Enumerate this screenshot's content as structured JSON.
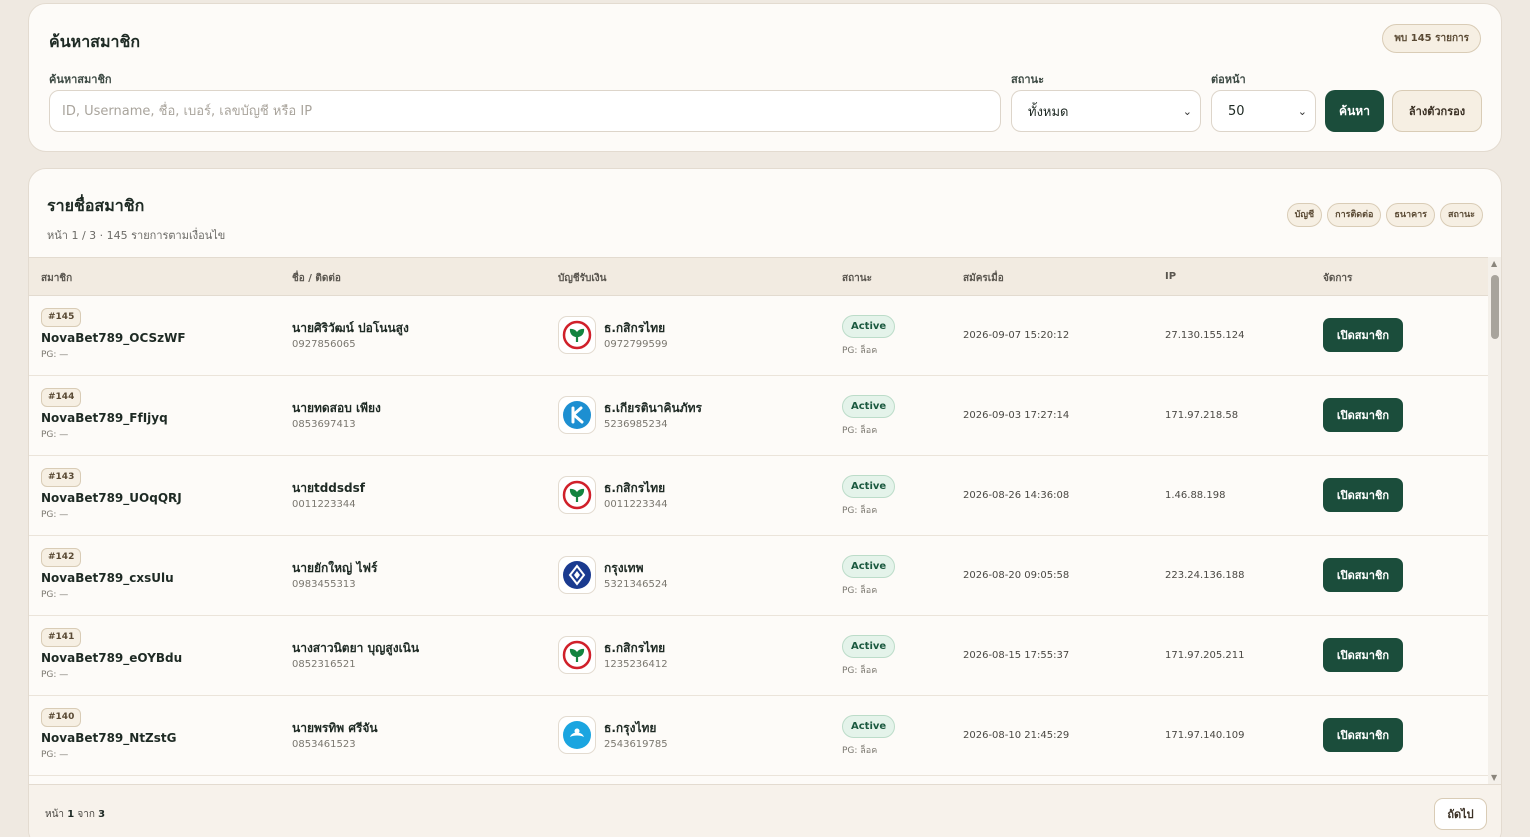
{
  "search": {
    "title": "ค้นหาสมาชิก",
    "count_badge": "พบ 145 รายการ",
    "search_label": "ค้นหาสมาชิก",
    "search_placeholder": "ID, Username, ชื่อ, เบอร์, เลขบัญชี หรือ IP",
    "search_value": "",
    "status_label": "สถานะ",
    "status_value": "ทั้งหมด",
    "per_page_label": "ต่อหน้า",
    "per_page_value": "50",
    "search_button": "ค้นหา",
    "clear_button": "ล้างตัวกรอง"
  },
  "list": {
    "title": "รายชื่อสมาชิก",
    "subtitle": "หน้า 1 / 3 · 145 รายการตามเงื่อนไข",
    "chips": [
      "บัญชี",
      "การติดต่อ",
      "ธนาคาร",
      "สถานะ"
    ],
    "columns": [
      "สมาชิก",
      "ชื่อ / ติดต่อ",
      "บัญชีรับเงิน",
      "สถานะ",
      "สมัครเมื่อ",
      "IP",
      "จัดการ"
    ],
    "rows": [
      {
        "id": "#145",
        "username": "NovaBet789_OCSzWF",
        "pg": "PG: —",
        "name": "นายศิริวัฒน์ ปอโนนสูง",
        "phone": "0927856065",
        "bank_name": "ธ.กสิกรไทย",
        "bank_acc": "0972799599",
        "bank_icon": "kbank-icon",
        "status": "Active",
        "status_pg": "PG: ล็อค",
        "date": "2026-09-07 15:20:12",
        "ip": "27.130.155.124",
        "action": "เปิดสมาชิก"
      },
      {
        "id": "#144",
        "username": "NovaBet789_FfIjyq",
        "pg": "PG: —",
        "name": "นายทดสอบ เพียง",
        "phone": "0853697413",
        "bank_name": "ธ.เกียรตินาคินภัทร",
        "bank_acc": "5236985234",
        "bank_icon": "kkp-icon",
        "status": "Active",
        "status_pg": "PG: ล็อค",
        "date": "2026-09-03 17:27:14",
        "ip": "171.97.218.58",
        "action": "เปิดสมาชิก"
      },
      {
        "id": "#143",
        "username": "NovaBet789_UOqQRJ",
        "pg": "PG: —",
        "name": "นายtddsdsf",
        "phone": "0011223344",
        "bank_name": "ธ.กสิกรไทย",
        "bank_acc": "0011223344",
        "bank_icon": "kbank-icon",
        "status": "Active",
        "status_pg": "PG: ล็อค",
        "date": "2026-08-26 14:36:08",
        "ip": "1.46.88.198",
        "action": "เปิดสมาชิก"
      },
      {
        "id": "#142",
        "username": "NovaBet789_cxsUlu",
        "pg": "PG: —",
        "name": "นายยักใหญ่ ไฟร์",
        "phone": "0983455313",
        "bank_name": "กรุงเทพ",
        "bank_acc": "5321346524",
        "bank_icon": "bbl-icon",
        "status": "Active",
        "status_pg": "PG: ล็อค",
        "date": "2026-08-20 09:05:58",
        "ip": "223.24.136.188",
        "action": "เปิดสมาชิก"
      },
      {
        "id": "#141",
        "username": "NovaBet789_eOYBdu",
        "pg": "PG: —",
        "name": "นางสาวนิตยา บุญสูงเนิน",
        "phone": "0852316521",
        "bank_name": "ธ.กสิกรไทย",
        "bank_acc": "1235236412",
        "bank_icon": "kbank-icon",
        "status": "Active",
        "status_pg": "PG: ล็อค",
        "date": "2026-08-15 17:55:37",
        "ip": "171.97.205.211",
        "action": "เปิดสมาชิก"
      },
      {
        "id": "#140",
        "username": "NovaBet789_NtZstG",
        "pg": "PG: —",
        "name": "นายพรทิพ ศรีจัน",
        "phone": "0853461523",
        "bank_name": "ธ.กรุงไทย",
        "bank_acc": "2543619785",
        "bank_icon": "ktb-icon",
        "status": "Active",
        "status_pg": "PG: ล็อค",
        "date": "2026-08-10 21:45:29",
        "ip": "171.97.140.109",
        "action": "เปิดสมาชิก"
      }
    ]
  },
  "footer": {
    "page_prefix": "หน้า",
    "current_page": "1",
    "page_of": "จาก",
    "total_pages": "3",
    "next_button": "ถัดไป"
  },
  "colors": {
    "primary": "#1b4d3b",
    "background": "#efe9e1",
    "card": "#fdfbf8",
    "status_active": "#e4f3ea"
  }
}
